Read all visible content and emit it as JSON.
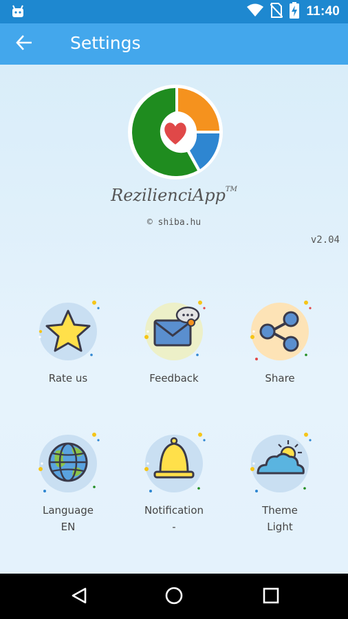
{
  "status_bar": {
    "time": "11:40"
  },
  "app_bar": {
    "title": "Settings"
  },
  "brand": {
    "name": "RezilienciApp",
    "tm": "TM",
    "copyright": "© shiba.hu",
    "version": "v2.04"
  },
  "settings": {
    "rate": {
      "label": "Rate us"
    },
    "feedback": {
      "label": "Feedback"
    },
    "share": {
      "label": "Share"
    },
    "language": {
      "label": "Language",
      "value": "EN"
    },
    "notification": {
      "label": "Notification",
      "value": "-"
    },
    "theme": {
      "label": "Theme",
      "value": "Light"
    }
  },
  "colors": {
    "status_bar": "#1e88d0",
    "app_bar": "#43a7ec",
    "logo_green": "#1f8c1f",
    "logo_orange": "#f5921e",
    "logo_blue": "#2e86d1",
    "heart": "#e04848"
  },
  "icons": [
    "android-icon",
    "wifi-icon",
    "no-sim-icon",
    "battery-charging-icon",
    "back-arrow-icon",
    "star-icon",
    "envelope-icon",
    "share-icon",
    "globe-icon",
    "bell-icon",
    "cloud-sun-icon",
    "nav-back-icon",
    "nav-home-icon",
    "nav-recents-icon"
  ]
}
